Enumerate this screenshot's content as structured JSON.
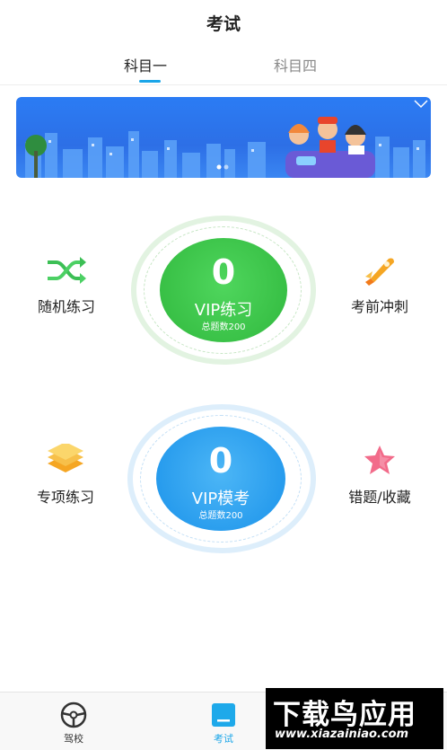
{
  "header": {
    "title": "考试"
  },
  "tabs": [
    {
      "label": "科目一",
      "active": true
    },
    {
      "label": "科目四",
      "active": false
    }
  ],
  "features": {
    "random": {
      "label": "随机练习",
      "icon": "shuffle-icon"
    },
    "sprint": {
      "label": "考前冲刺",
      "icon": "rocket-icon"
    },
    "special": {
      "label": "专项练习",
      "icon": "layers-icon"
    },
    "mistakes": {
      "label": "错题/收藏",
      "icon": "star-icon"
    }
  },
  "vip_practice": {
    "count": "0",
    "label": "VIP练习",
    "sub": "总题数200",
    "color": "#3cc84a"
  },
  "vip_exam": {
    "count": "0",
    "label": "VIP模考",
    "sub": "总题数200",
    "color": "#1e9bf0"
  },
  "bottom_nav": [
    {
      "label": "驾校",
      "icon": "steering-wheel-icon",
      "active": false
    },
    {
      "label": "考试",
      "icon": "exam-icon",
      "active": true
    }
  ],
  "watermark": {
    "title": "下载鸟应用",
    "url": "www.xiazainiao.com"
  },
  "colors": {
    "accent": "#1aa5e8",
    "green": "#3cc84a",
    "blue": "#1e9bf0"
  }
}
